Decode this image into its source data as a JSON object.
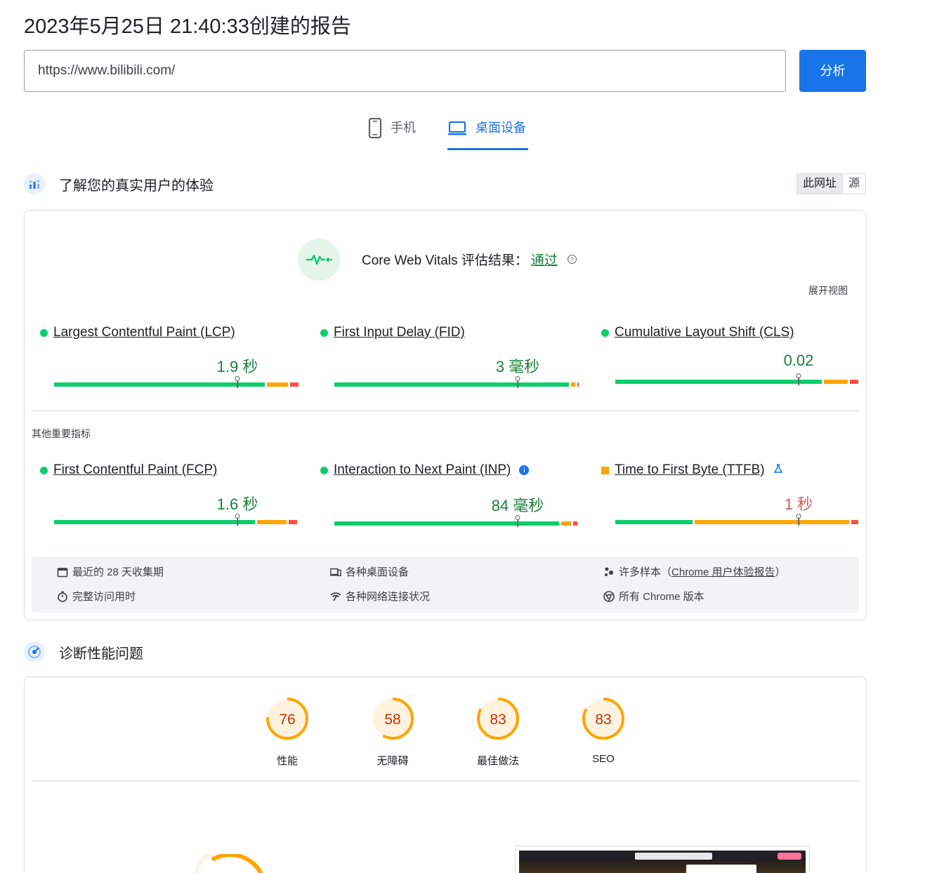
{
  "header": {
    "title": "2023年5月25日 21:40:33创建的报告",
    "url_value": "https://www.bilibili.com/",
    "analyze_label": "分析"
  },
  "tabs": [
    {
      "label": "手机",
      "icon": "phone-icon",
      "active": false
    },
    {
      "label": "桌面设备",
      "icon": "laptop-icon",
      "active": true
    }
  ],
  "field_section": {
    "title": "了解您的真实用户的体验",
    "toggle": {
      "this_url": "此网址",
      "origin": "源"
    },
    "cwv": {
      "label": "Core Web Vitals 评估结果：",
      "result": "通过",
      "expand": "展开视图"
    },
    "core_metrics": [
      {
        "name": "Largest Contentful Paint (LCP)",
        "value": "1.9 秒",
        "status": "good",
        "marker": 0.75
      },
      {
        "name": "First Input Delay (FID)",
        "value": "3 毫秒",
        "status": "good",
        "marker": 0.75
      },
      {
        "name": "Cumulative Layout Shift (CLS)",
        "value": "0.02",
        "status": "good",
        "marker": 0.75
      }
    ],
    "other_label": "其他重要指标",
    "other_metrics": [
      {
        "name": "First Contentful Paint (FCP)",
        "value": "1.6 秒",
        "status": "good",
        "marker": 0.75
      },
      {
        "name": "Interaction to Next Paint (INP)",
        "value": "84 毫秒",
        "status": "good",
        "marker": 0.75
      },
      {
        "name": "Time to First Byte (TTFB)",
        "value": "1 秒",
        "status": "needs-improvement",
        "marker": 0.75
      }
    ],
    "info": {
      "period": "最近的 28 天收集期",
      "devices": "各种桌面设备",
      "samples_prefix": "许多样本（",
      "samples_link": "Chrome 用户体验报告",
      "samples_suffix": "）",
      "duration": "完整访问用时",
      "network": "各种网络连接状况",
      "chrome": "所有 Chrome 版本"
    }
  },
  "diagnose_section": {
    "title": "诊断性能问题",
    "scores": [
      {
        "score": "76",
        "label": "性能"
      },
      {
        "score": "58",
        "label": "无障碍"
      },
      {
        "score": "83",
        "label": "最佳做法"
      },
      {
        "score": "83",
        "label": "SEO"
      }
    ]
  },
  "colors": {
    "accent": "#1a73e8",
    "good": "#0cce6b",
    "average": "#ffa400",
    "poor": "#ff4e42"
  }
}
